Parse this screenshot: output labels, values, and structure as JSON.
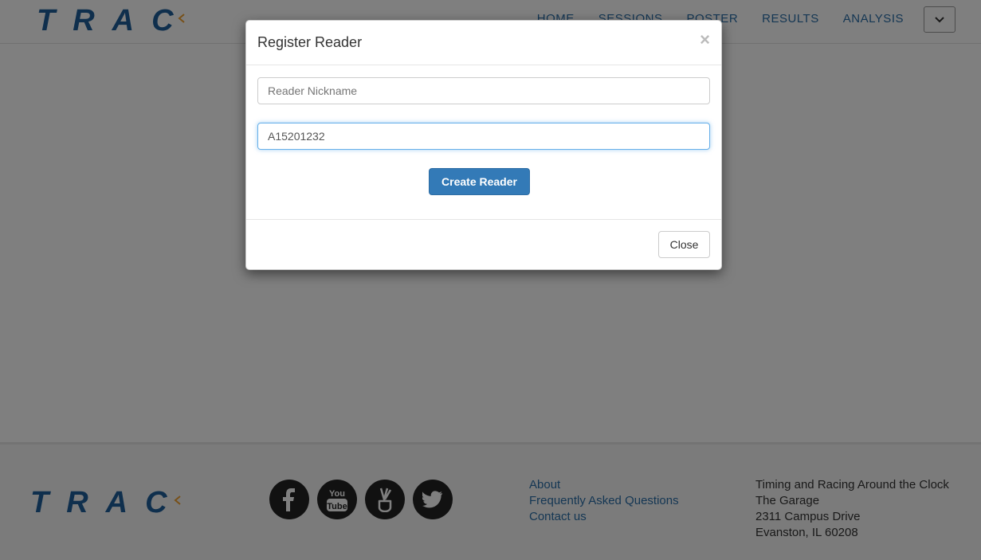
{
  "navbar": {
    "logo_text": "TRAC",
    "links": [
      "HOME",
      "SESSIONS",
      "POSTER",
      "RESULTS",
      "ANALYSIS"
    ],
    "toggle_icon": "chevron-down-icon"
  },
  "modal": {
    "title": "Register Reader",
    "close_symbol": "×",
    "nickname_placeholder": "Reader Nickname",
    "nickname_value": "",
    "serial_value": "A15201232",
    "create_label": "Create Reader",
    "close_label": "Close"
  },
  "footer": {
    "logo_text": "TRAC",
    "socials": [
      "facebook-icon",
      "youtube-icon",
      "angellist-icon",
      "twitter-icon"
    ],
    "links": [
      "About",
      "Frequently Asked Questions",
      "Contact us"
    ],
    "address": [
      "Timing and Racing Around the Clock",
      "The Garage",
      "2311 Campus Drive",
      "Evanston, IL 60208"
    ]
  },
  "colors": {
    "brand_blue": "#1f5f9b",
    "brand_orange": "#f0a030",
    "primary_button": "#337ab7",
    "link": "#2a6ea8"
  }
}
